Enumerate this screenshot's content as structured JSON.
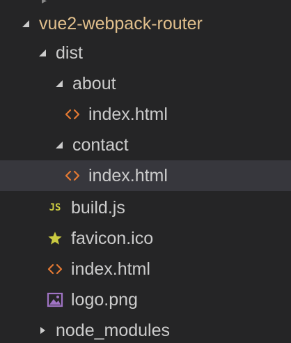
{
  "tree": {
    "root": {
      "label": "vue2-webpack-router",
      "expanded": true,
      "color": "#e2c08d"
    },
    "items": [
      {
        "label": "dist",
        "type": "folder",
        "expanded": true
      },
      {
        "label": "about",
        "type": "folder",
        "expanded": true
      },
      {
        "label": "index.html",
        "type": "file",
        "icon": "html-icon",
        "selected": false
      },
      {
        "label": "contact",
        "type": "folder",
        "expanded": true
      },
      {
        "label": "index.html",
        "type": "file",
        "icon": "html-icon",
        "selected": true
      },
      {
        "label": "build.js",
        "type": "file",
        "icon": "js-icon",
        "icon_text": "JS"
      },
      {
        "label": "favicon.ico",
        "type": "file",
        "icon": "star-icon"
      },
      {
        "label": "index.html",
        "type": "file",
        "icon": "html-icon"
      },
      {
        "label": "logo.png",
        "type": "file",
        "icon": "image-icon"
      },
      {
        "label": "node_modules",
        "type": "folder",
        "expanded": false
      }
    ]
  },
  "colors": {
    "background": "#252526",
    "selected_row": "#37373d",
    "text": "#cccccc",
    "root_label": "#e2c08d",
    "html_icon": "#e37933",
    "js_icon": "#cbcb41",
    "star_icon": "#cbcb41",
    "image_icon": "#a074c4"
  }
}
